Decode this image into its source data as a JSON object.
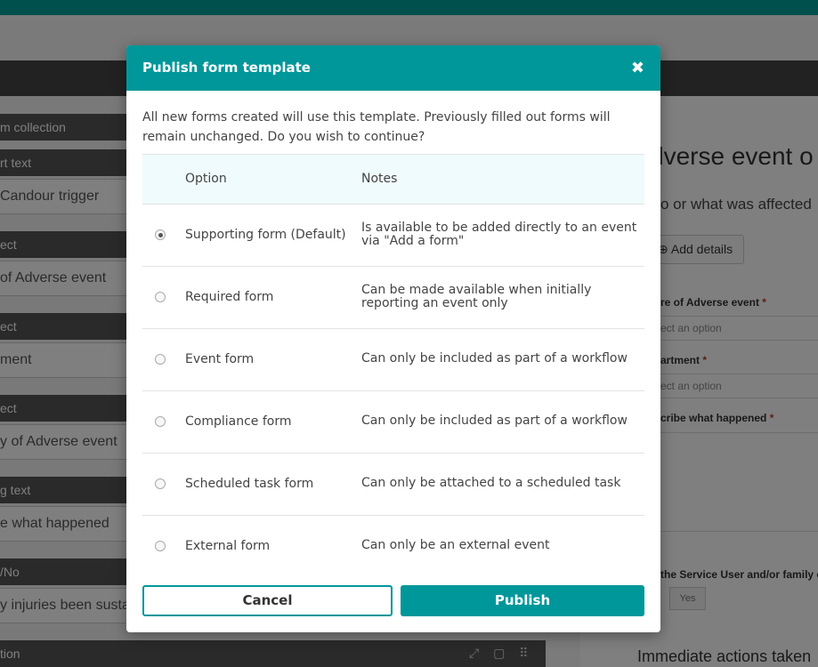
{
  "background": {
    "left_fields": [
      {
        "label": "m collection",
        "value": ""
      },
      {
        "label": "rt text",
        "value": "Candour trigger"
      },
      {
        "label": "ect",
        "value": "of Adverse event"
      },
      {
        "label": "ect",
        "value": "ment"
      },
      {
        "label": "ect",
        "value": "y of Adverse event"
      },
      {
        "label": "g text",
        "value": "e what happened"
      },
      {
        "label": "/No",
        "value": "y injuries been susta"
      }
    ],
    "bottom_bar_label": "tion",
    "right": {
      "title": "dverse event o",
      "subtitle": "o or what was affected",
      "add_details": "Add details",
      "field1_label": "re of Adverse event",
      "field1_placeholder": "ect an option",
      "field2_label": "artment",
      "field2_placeholder": "ect an option",
      "field3_label": "cribe what happened",
      "question": "the Service User and/or family c",
      "yes": "Yes",
      "immediate": "Immediate actions taken"
    }
  },
  "modal": {
    "title": "Publish form template",
    "intro": "All new forms created will use this template. Previously filled out forms will remain unchanged. Do you wish to continue?",
    "headers": {
      "option": "Option",
      "notes": "Notes"
    },
    "rows": [
      {
        "option": "Supporting form (Default)",
        "notes": "Is available to be added directly to an event via \"Add a form\"",
        "checked": true
      },
      {
        "option": "Required form",
        "notes": "Can be made available when initially reporting an event only",
        "checked": false
      },
      {
        "option": "Event form",
        "notes": "Can only be included as part of a workflow",
        "checked": false
      },
      {
        "option": "Compliance form",
        "notes": "Can only be included as part of a workflow",
        "checked": false
      },
      {
        "option": "Scheduled task form",
        "notes": "Can only be attached to a scheduled task",
        "checked": false
      },
      {
        "option": "External form",
        "notes": "Can only be an external event",
        "checked": false
      }
    ],
    "cancel_label": "Cancel",
    "publish_label": "Publish"
  },
  "colors": {
    "accent": "#00979a",
    "header_bg": "#effbfc"
  }
}
